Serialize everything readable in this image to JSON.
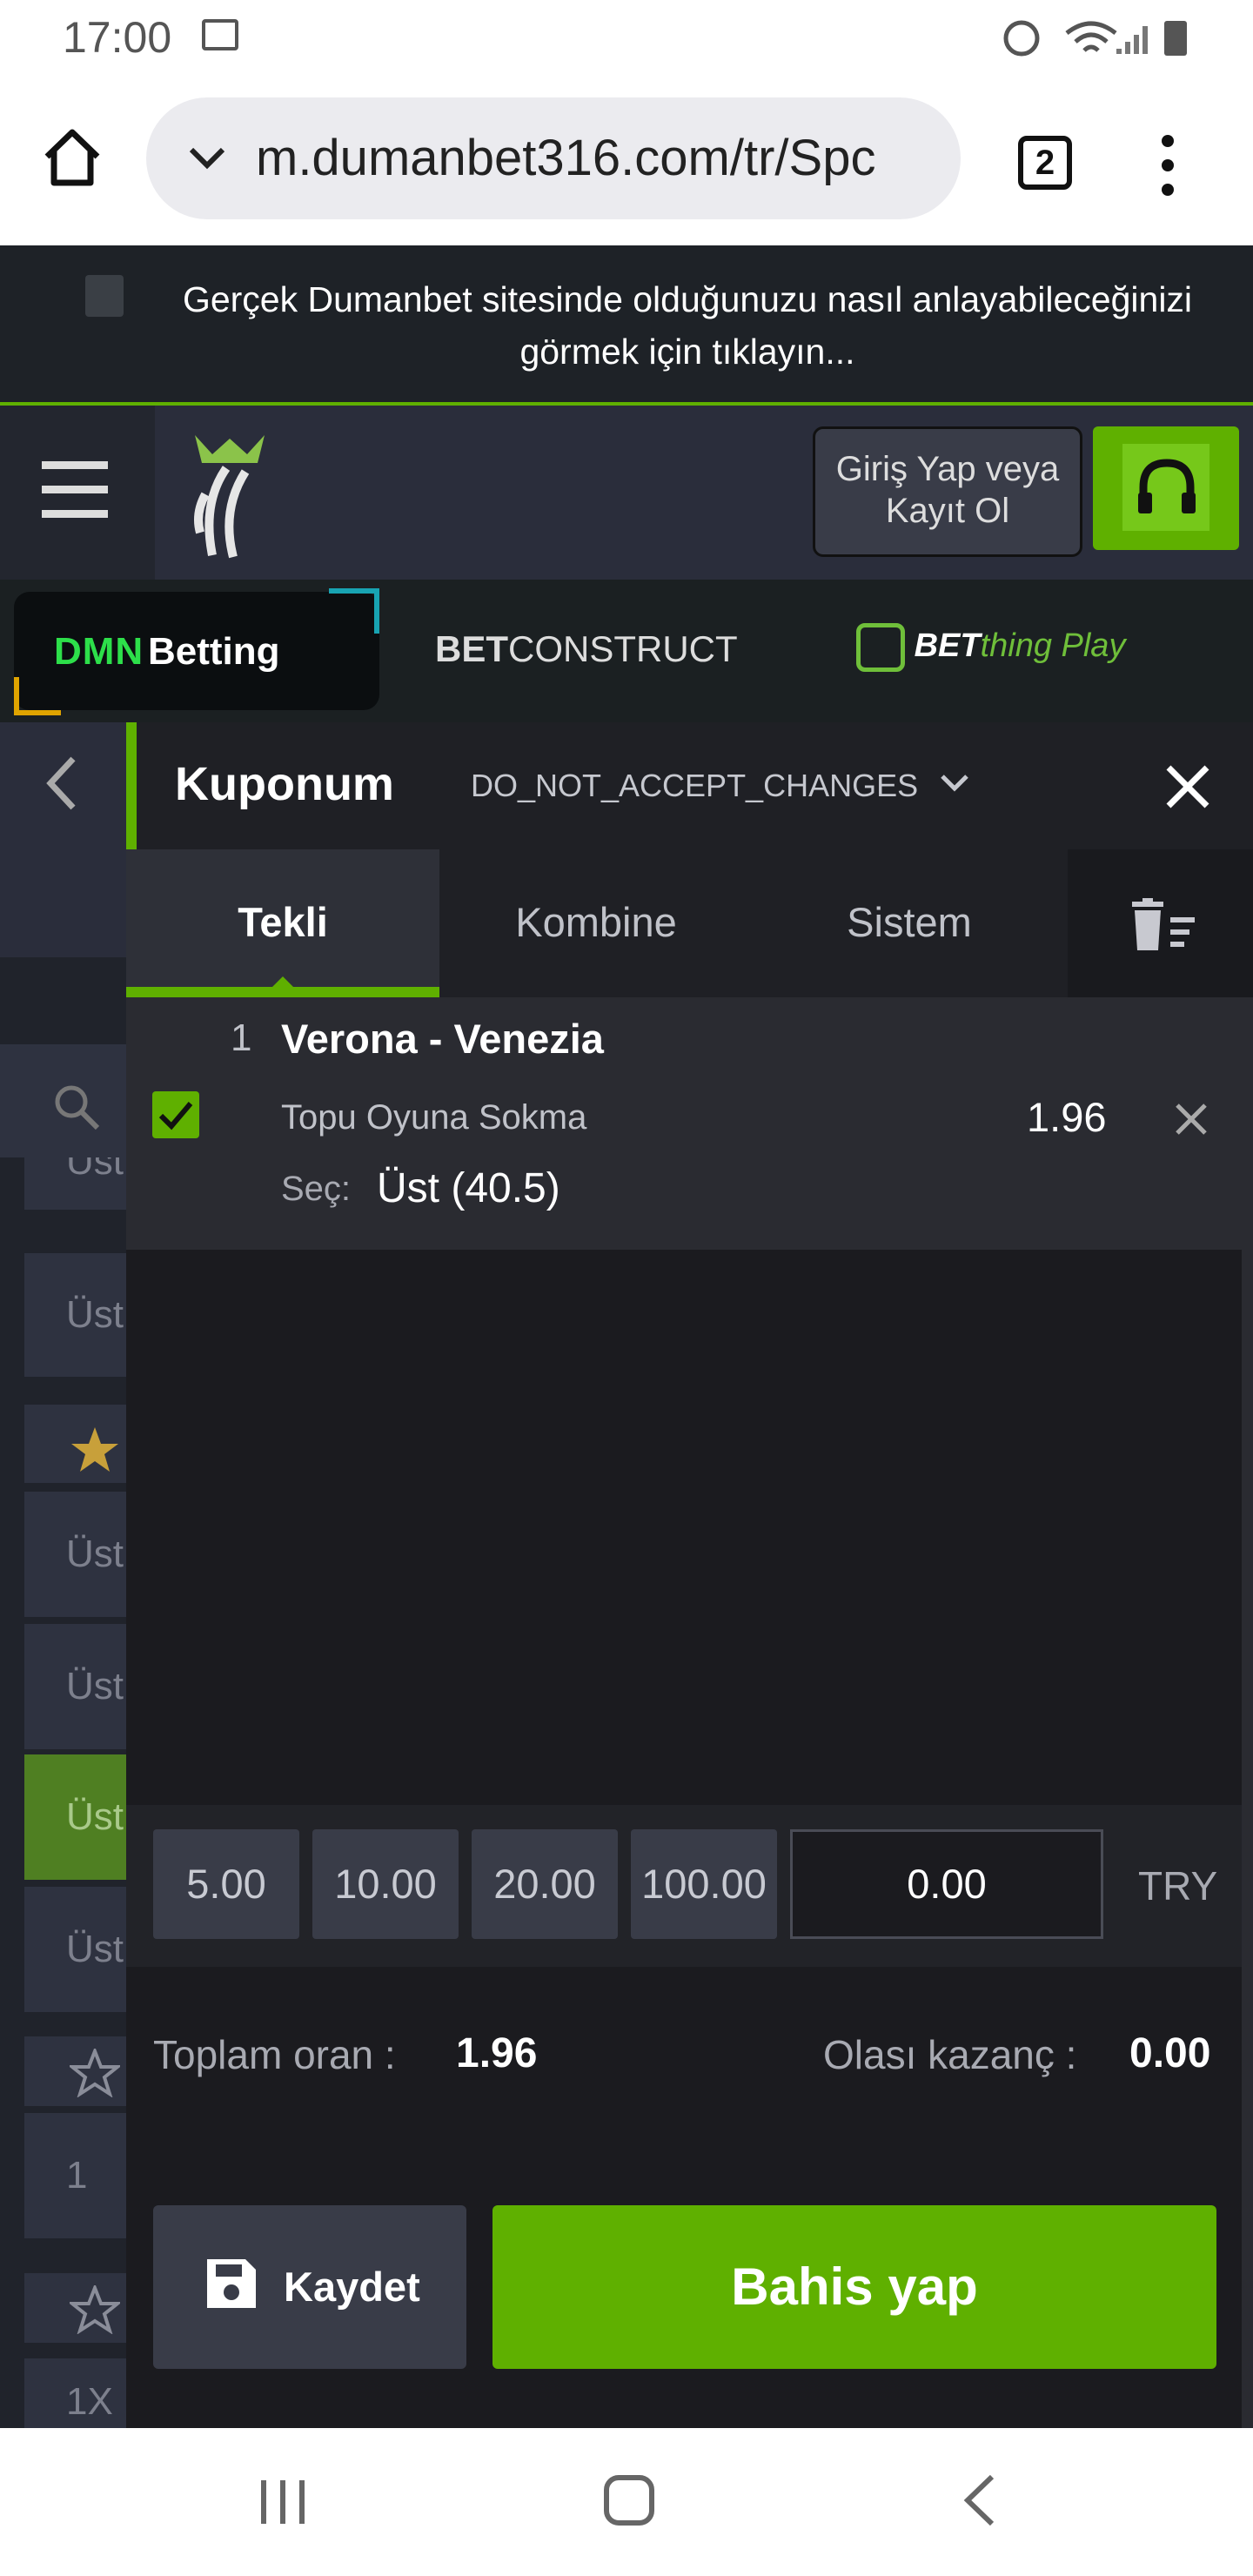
{
  "status": {
    "time": "17:00"
  },
  "browser": {
    "url": "m.dumanbet316.com/tr/Spc",
    "tab_count": "2"
  },
  "notice": {
    "line1": "Gerçek Dumanbet sitesinde olduğunuzu nasıl anlayabileceğinizi",
    "line2": "görmek için tıklayın..."
  },
  "header": {
    "login_line1": "Giriş Yap veya",
    "login_line2": "Kayıt Ol"
  },
  "brands": {
    "b1_a": "DMN",
    "b1_b": "Betting",
    "b2_a": "BET",
    "b2_b": "CONSTRUCT",
    "b3_a": "BET",
    "b3_b": "thing Play"
  },
  "coupon": {
    "title": "Kuponum",
    "mode": "DO_NOT_ACCEPT_CHANGES",
    "tabs": [
      "Tekli",
      "Kombine",
      "Sistem"
    ],
    "bet": {
      "index": "1",
      "match": "Verona - Venezia",
      "market": "Topu Oyuna Sokma",
      "odds": "1.96",
      "pick_label": "Seç:",
      "pick": "Üst (40.5)"
    },
    "amounts": [
      "5.00",
      "10.00",
      "20.00",
      "100.00"
    ],
    "stake": "0.00",
    "currency": "TRY",
    "total_odds_label": "Toplam oran :",
    "total_odds": "1.96",
    "possible_win_label": "Olası kazanç :",
    "possible_win": "0.00",
    "save_label": "Kaydet",
    "place_label": "Bahis yap"
  },
  "side": {
    "tiles": [
      "Üst",
      "Üst",
      "Üst",
      "Üst",
      "Üst",
      "Üst",
      "1",
      "1X"
    ]
  },
  "colors": {
    "accent": "#5fb000",
    "panel": "#1b1b1f",
    "tile": "#393c48"
  }
}
